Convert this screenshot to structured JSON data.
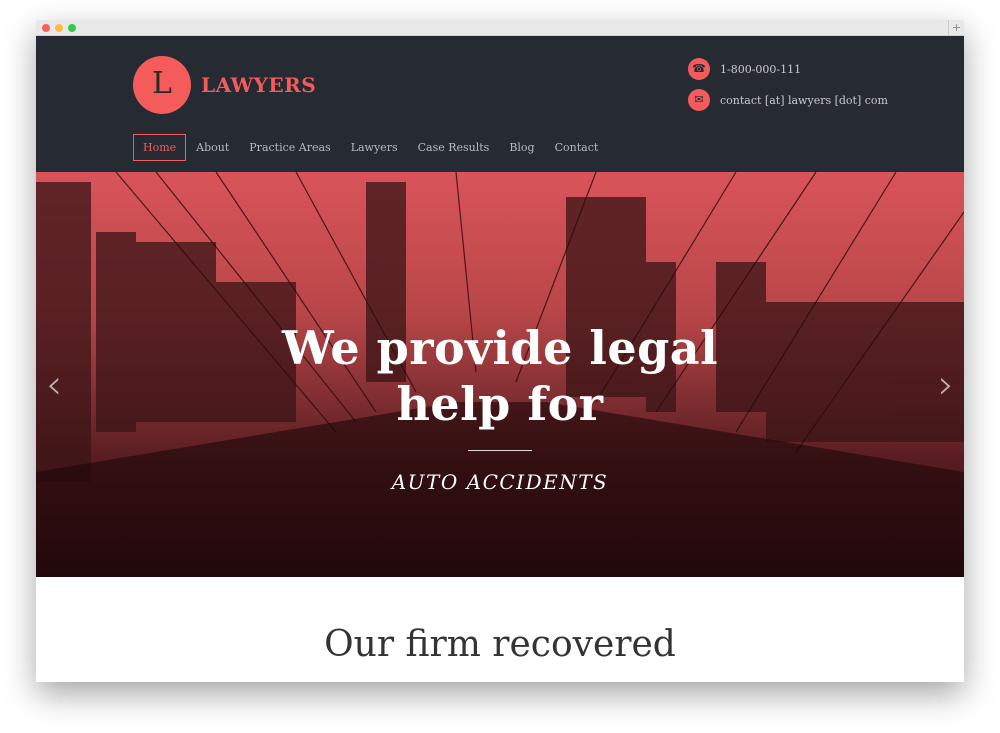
{
  "brand": {
    "initial": "L",
    "name": "LAWYERS",
    "accent": "#f45b5b"
  },
  "contact": {
    "phone": "1-800-000-111",
    "email": "contact [at] lawyers [dot] com"
  },
  "nav": [
    "Home",
    "About",
    "Practice Areas",
    "Lawyers",
    "Case Results",
    "Blog",
    "Contact"
  ],
  "hero": {
    "line1": "We provide legal",
    "line2": "help for",
    "subtitle": "AUTO ACCIDENTS"
  },
  "section": {
    "title": "Our firm recovered"
  }
}
